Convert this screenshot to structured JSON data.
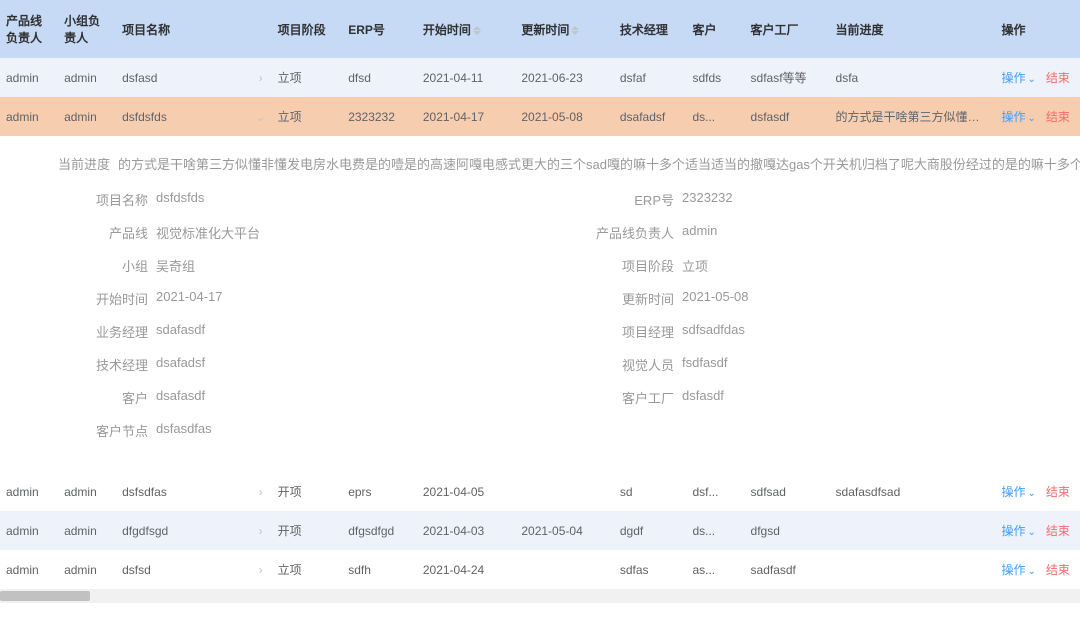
{
  "columns": [
    "产品线负责人",
    "小组负责人",
    "项目名称",
    "项目阶段",
    "ERP号",
    "开始时间",
    "更新时间",
    "技术经理",
    "客户",
    "客户工厂",
    "当前进度",
    "操作"
  ],
  "actions": {
    "op": "操作",
    "end": "结束"
  },
  "sortable": [
    5,
    6
  ],
  "rows": [
    {
      "pl": "admin",
      "team": "admin",
      "name": "dsfasd",
      "exp": "right",
      "phase": "立项",
      "erp": "dfsd",
      "start": "2021-04-11",
      "update": "2021-06-23",
      "tech": "dsfaf",
      "cust": "sdfds",
      "fact": "sdfasf等等",
      "prog": "dsfa"
    },
    {
      "pl": "admin",
      "team": "admin",
      "name": "dsfdsfds",
      "exp": "down",
      "phase": "立项",
      "erp": "2323232",
      "start": "2021-04-17",
      "update": "2021-05-08",
      "tech": "dsafadsf",
      "cust": "ds...",
      "fact": "dsfasdf",
      "prog": "的方式是干啥第三方似懂非懂发不"
    }
  ],
  "detail": {
    "prog_label": "当前进度",
    "prog": "的方式是干啥第三方似懂非懂发电房水电费是的噎是的高速阿嘎电感式更大的三个sad嘎的嘛十多个适当适当的撤嘎达gas个开关机归档了呢大商股份经过的是的嘛十多个阿萨德刚树大根深动感给大哥大帅哥大的是光和热大方得很发放的好好梵蒂冈阿嘎大风歌发过的发鬼地方个大风刷地方个发的广泛地规范打个梵蒂冈的方式是干啥第三方似懂非懂发电房水电费是的噎是的高速阿嘎电感式更大的三个sad嘎的嘛十多个适当适当的撤嘎达gas个开关机归档了呢大商股份经过",
    "fields": [
      {
        "l": "项目名称",
        "v": "dsfdsfds"
      },
      {
        "l": "ERP号",
        "v": "2323232"
      },
      {
        "l": "产品线",
        "v": "视觉标准化大平台"
      },
      {
        "l": "产品线负责人",
        "v": "admin"
      },
      {
        "l": "小组",
        "v": "吴奇组"
      },
      {
        "l": "项目阶段",
        "v": "立项"
      },
      {
        "l": "开始时间",
        "v": "2021-04-17"
      },
      {
        "l": "更新时间",
        "v": "2021-05-08"
      },
      {
        "l": "业务经理",
        "v": "sdafasdf"
      },
      {
        "l": "项目经理",
        "v": "sdfsadfdas"
      },
      {
        "l": "技术经理",
        "v": "dsafadsf"
      },
      {
        "l": "视觉人员",
        "v": "fsdfasdf"
      },
      {
        "l": "客户",
        "v": "dsafasdf"
      },
      {
        "l": "客户工厂",
        "v": "dsfasdf"
      },
      {
        "l": "客户节点",
        "v": "dsfasdfas"
      }
    ]
  },
  "rows_after": [
    {
      "pl": "admin",
      "team": "admin",
      "name": "dsfsdfas",
      "exp": "right",
      "phase": "开项",
      "erp": "eprs",
      "start": "2021-04-05",
      "update": "",
      "tech": "sd",
      "cust": "dsf...",
      "fact": "sdfsad",
      "prog": "sdafasdfsad"
    },
    {
      "pl": "admin",
      "team": "admin",
      "name": "dfgdfsgd",
      "exp": "right",
      "phase": "开项",
      "erp": "dfgsdfgd",
      "start": "2021-04-03",
      "update": "2021-05-04",
      "tech": "dgdf",
      "cust": "ds...",
      "fact": "dfgsd",
      "prog": ""
    },
    {
      "pl": "admin",
      "team": "admin",
      "name": "dsfsd",
      "exp": "right",
      "phase": "立项",
      "erp": "sdfh",
      "start": "2021-04-24",
      "update": "",
      "tech": "sdfas",
      "cust": "as...",
      "fact": "sadfasdf",
      "prog": ""
    }
  ]
}
